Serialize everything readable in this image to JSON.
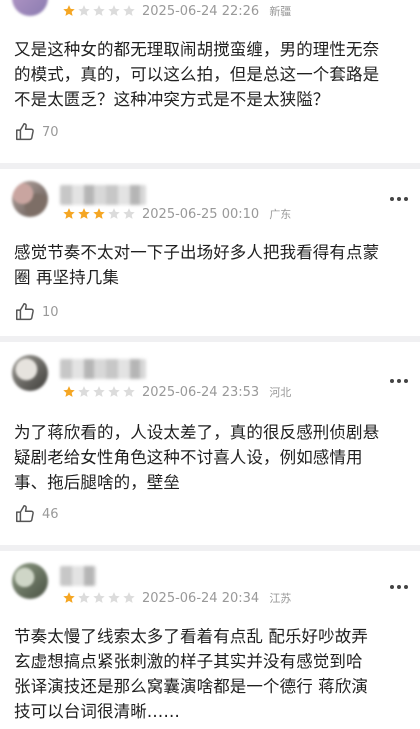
{
  "reviews": [
    {
      "stars": 1,
      "date": "2025-06-24",
      "time": "22:26",
      "region": "新疆",
      "lines": [
        "又是这种女的都无理取闹胡搅蛮缠，男的理性无奈",
        "的模式，真的，可以这么拍，但是总这一个套路是",
        "不是太匮乏？这种冲突方式是不是太狭隘？"
      ],
      "likes": "70"
    },
    {
      "stars": 3,
      "date": "2025-06-25",
      "time": "00:10",
      "region": "广东",
      "lines": [
        "感觉节奏不太对一下子出场好多人把我看得有点蒙",
        "圈  再坚持几集"
      ],
      "likes": "10"
    },
    {
      "stars": 1,
      "date": "2025-06-24",
      "time": "23:53",
      "region": "河北",
      "lines": [
        "为了蒋欣看的，人设太差了，真的很反感刑侦剧悬",
        "疑剧老给女性角色这种不讨喜人设，例如感情用",
        "事、拖后腿啥的，壁垒"
      ],
      "likes": "46"
    },
    {
      "stars": 1,
      "date": "2025-06-24",
      "time": "20:34",
      "region": "江苏",
      "lines": [
        "节奏太慢了线索太多了看着有点乱  配乐好吵故弄",
        "玄虚想搞点紧张刺激的样子其实并没有感觉到哈",
        "张译演技还是那么窝囊演啥都是一个德行  蒋欣演",
        "技可以台词很清晰……"
      ],
      "likes": ""
    }
  ],
  "colors": {
    "star_filled": "#f5a623",
    "star_empty": "#dcdcdc",
    "meta_text": "#999999",
    "separator": "#f0f0f2"
  },
  "icons": {
    "like": "thumbs-up-icon",
    "more": "more-icon"
  }
}
